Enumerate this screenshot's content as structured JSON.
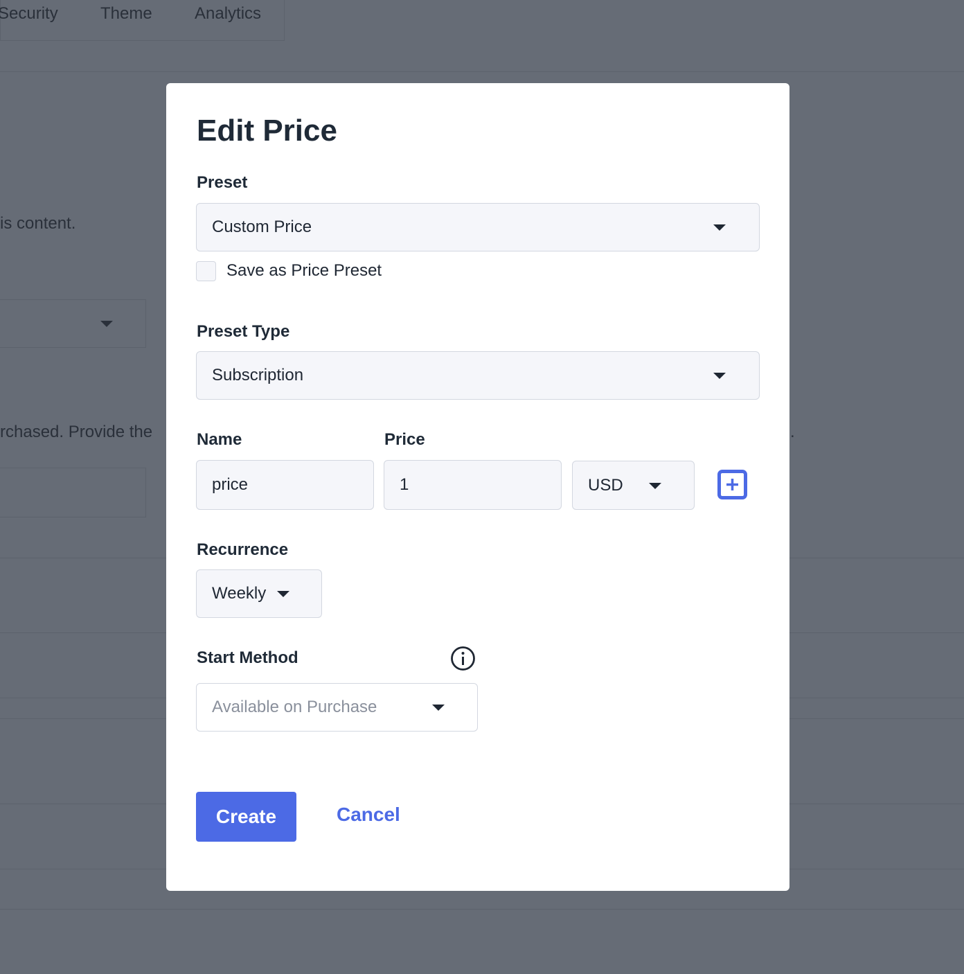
{
  "background": {
    "tabs": [
      "Security",
      "Theme",
      "Analytics"
    ],
    "text1": "is content.",
    "text2": "rchased. Provide the",
    "text3": "."
  },
  "modal": {
    "title": "Edit Price",
    "preset": {
      "label": "Preset",
      "value": "Custom Price"
    },
    "save_preset": {
      "label": "Save as Price Preset",
      "checked": false
    },
    "preset_type": {
      "label": "Preset Type",
      "value": "Subscription"
    },
    "name": {
      "label": "Name",
      "value": "price"
    },
    "price": {
      "label": "Price",
      "value": "1"
    },
    "currency": {
      "value": "USD"
    },
    "add_icon": "plus-square-icon",
    "recurrence": {
      "label": "Recurrence",
      "value": "Weekly"
    },
    "start_method": {
      "label": "Start Method",
      "placeholder": "Available on Purchase",
      "info_icon": "info-circle-icon"
    },
    "create_label": "Create",
    "cancel_label": "Cancel"
  },
  "colors": {
    "accent": "#4c6ae5",
    "overlay": "#666c76",
    "field_bg": "#f5f6fa"
  }
}
